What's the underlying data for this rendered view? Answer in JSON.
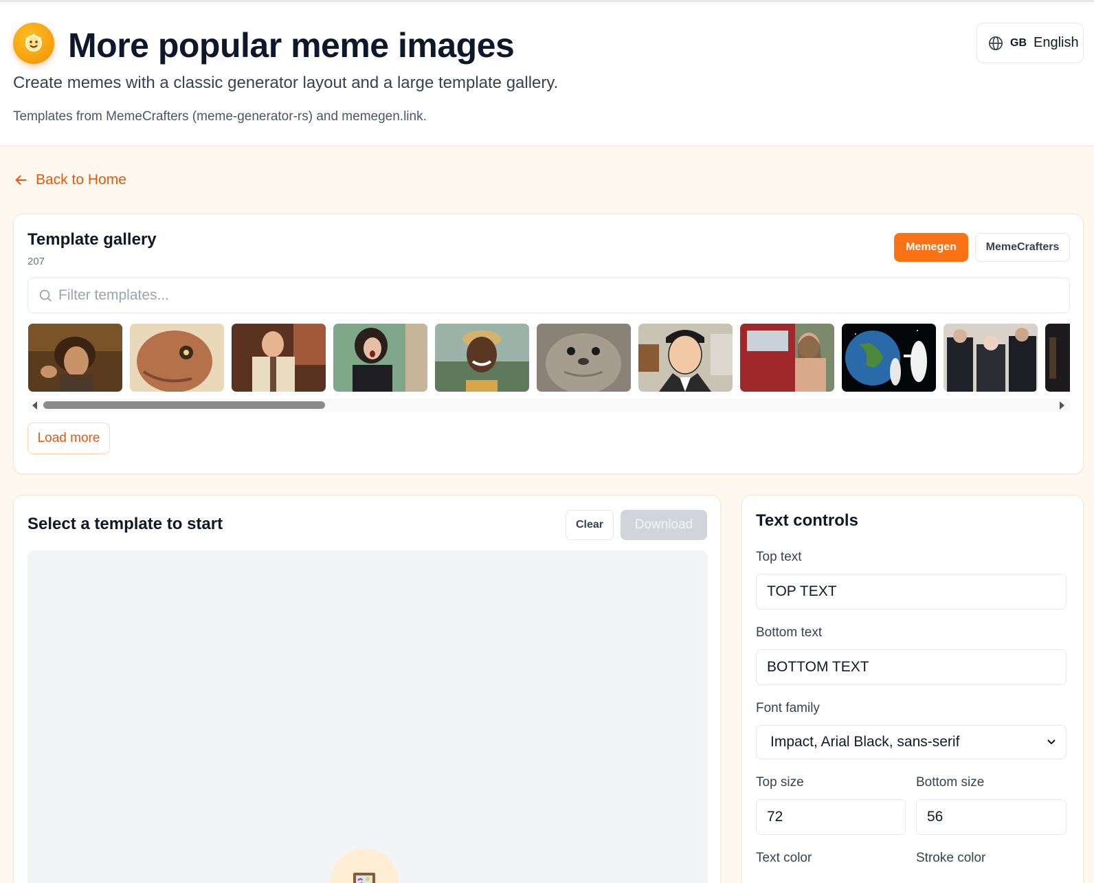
{
  "header": {
    "title": "More popular meme images",
    "subtitle": "Create memes with a classic generator layout and a large template gallery.",
    "credits": "Templates from MemeCrafters (meme-generator-rs) and memegen.link."
  },
  "language": {
    "code": "GB",
    "label": "English"
  },
  "nav": {
    "back_label": "Back to Home"
  },
  "gallery": {
    "title": "Template gallery",
    "count": "207",
    "sources": [
      "Memegen",
      "MemeCrafters"
    ],
    "active_source": "Memegen",
    "filter_placeholder": "Filter templates...",
    "load_more_label": "Load more",
    "thumbnails": [
      "ancient-aliens-guy",
      "admiral-ackbar",
      "andy-dwyer-shocked",
      "agatha-harkness-shouting",
      "sweet-brown",
      "awkward-seal",
      "archer",
      "redneck-mullet-man",
      "astronaut-always-has-been",
      "laughing-old-men",
      "partial-next-template"
    ]
  },
  "editor": {
    "title": "Select a template to start",
    "clear_label": "Clear",
    "download_label": "Download",
    "placeholder_icon": "framed-picture-icon"
  },
  "controls": {
    "title": "Text controls",
    "top_text_label": "Top text",
    "top_text_value": "TOP TEXT",
    "bottom_text_label": "Bottom text",
    "bottom_text_value": "BOTTOM TEXT",
    "font_family_label": "Font family",
    "font_family_value": "Impact, Arial Black, sans-serif",
    "top_size_label": "Top size",
    "top_size_value": "72",
    "bottom_size_label": "Bottom size",
    "bottom_size_value": "56",
    "text_color_label": "Text color",
    "stroke_color_label": "Stroke color"
  },
  "colors": {
    "accent": "#f97316",
    "accent_text": "#ea580c",
    "page_bg": "#fff8ee"
  }
}
